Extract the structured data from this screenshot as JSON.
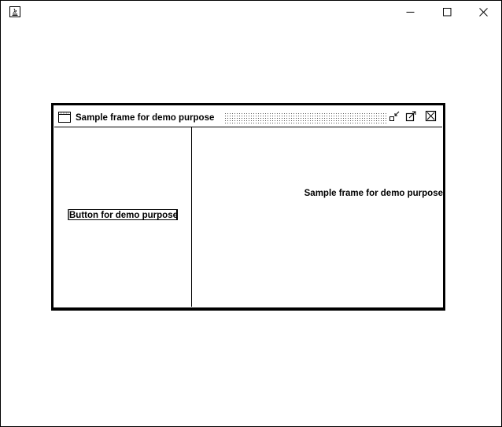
{
  "outer_window": {
    "app_icon": "java-cup-icon",
    "controls": {
      "minimize": "minimize-icon",
      "maximize": "maximize-icon",
      "close": "close-icon"
    }
  },
  "internal_frame": {
    "title": "Sample frame for demo purpose",
    "icon": "window-icon",
    "controls": {
      "iconify": "iconify-icon",
      "maximize": "maximize-icon",
      "close": "close-box-icon"
    }
  },
  "content": {
    "button_label": "Button for demo purpose",
    "right_label": "Sample frame for demo purpose"
  }
}
